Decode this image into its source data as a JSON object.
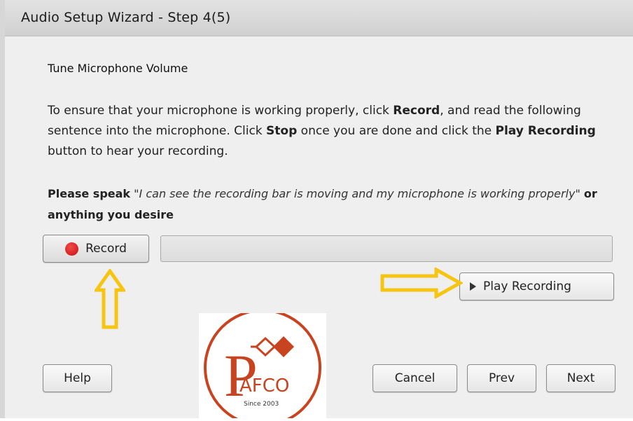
{
  "window": {
    "title": "Audio Setup Wizard - Step 4(5)"
  },
  "heading": "Tune Microphone Volume",
  "instructions": {
    "t1": "To ensure that your microphone is working properly, click ",
    "b1": "Record",
    "t2": ", and read the following sentence into the microphone. Click ",
    "b2": "Stop",
    "t3": " once you are done and click the ",
    "b3": "Play Recording",
    "t4": " button to hear your recording."
  },
  "prompt": {
    "lead": "Please speak",
    "quote": "\"I can see the recording bar is moving and my microphone is working properly\"",
    "tail": "or anything you desire"
  },
  "buttons": {
    "record": "Record",
    "play_recording": "Play Recording",
    "help": "Help",
    "cancel": "Cancel",
    "prev": "Prev",
    "next": "Next"
  },
  "recording_level": 0,
  "icons": {
    "record": "record-dot-icon",
    "play": "play-triangle-icon",
    "annotation_up": "arrow-up-icon",
    "annotation_right": "arrow-right-icon"
  },
  "logo": {
    "text": "AFCO",
    "initial": "P",
    "tagline": "Since 2003"
  },
  "colors": {
    "record_red": "#d91b1b",
    "annotation_yellow": "#f6c413",
    "logo_red": "#c8431f"
  }
}
